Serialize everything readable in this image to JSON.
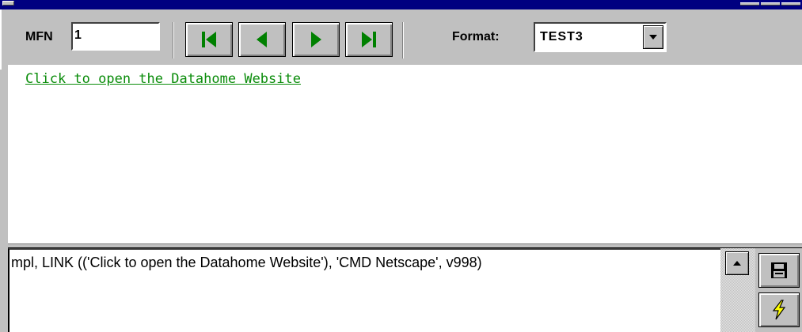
{
  "toolbar": {
    "mfn_label": "MFN",
    "mfn_value": "1",
    "nav_buttons": [
      {
        "name": "first-record",
        "icon": "skip-to-first-icon"
      },
      {
        "name": "previous-record",
        "icon": "triangle-left-icon"
      },
      {
        "name": "next-record",
        "icon": "triangle-right-icon"
      },
      {
        "name": "last-record",
        "icon": "skip-to-last-icon"
      }
    ],
    "format_label": "Format:",
    "format_value": "TEST3"
  },
  "display": {
    "link_text": "Click to open the Datahome Website"
  },
  "editor": {
    "text": "mpl, LINK (('Click to open the Datahome Website'), 'CMD Netscape', v998)"
  },
  "side_buttons": [
    {
      "name": "save",
      "icon": "floppy-disk-icon"
    },
    {
      "name": "execute",
      "icon": "lightning-icon"
    }
  ],
  "colors": {
    "title_bar": "#000080",
    "nav_arrow": "#008000",
    "link": "#0a8c0a",
    "face": "#c0c0c0"
  }
}
